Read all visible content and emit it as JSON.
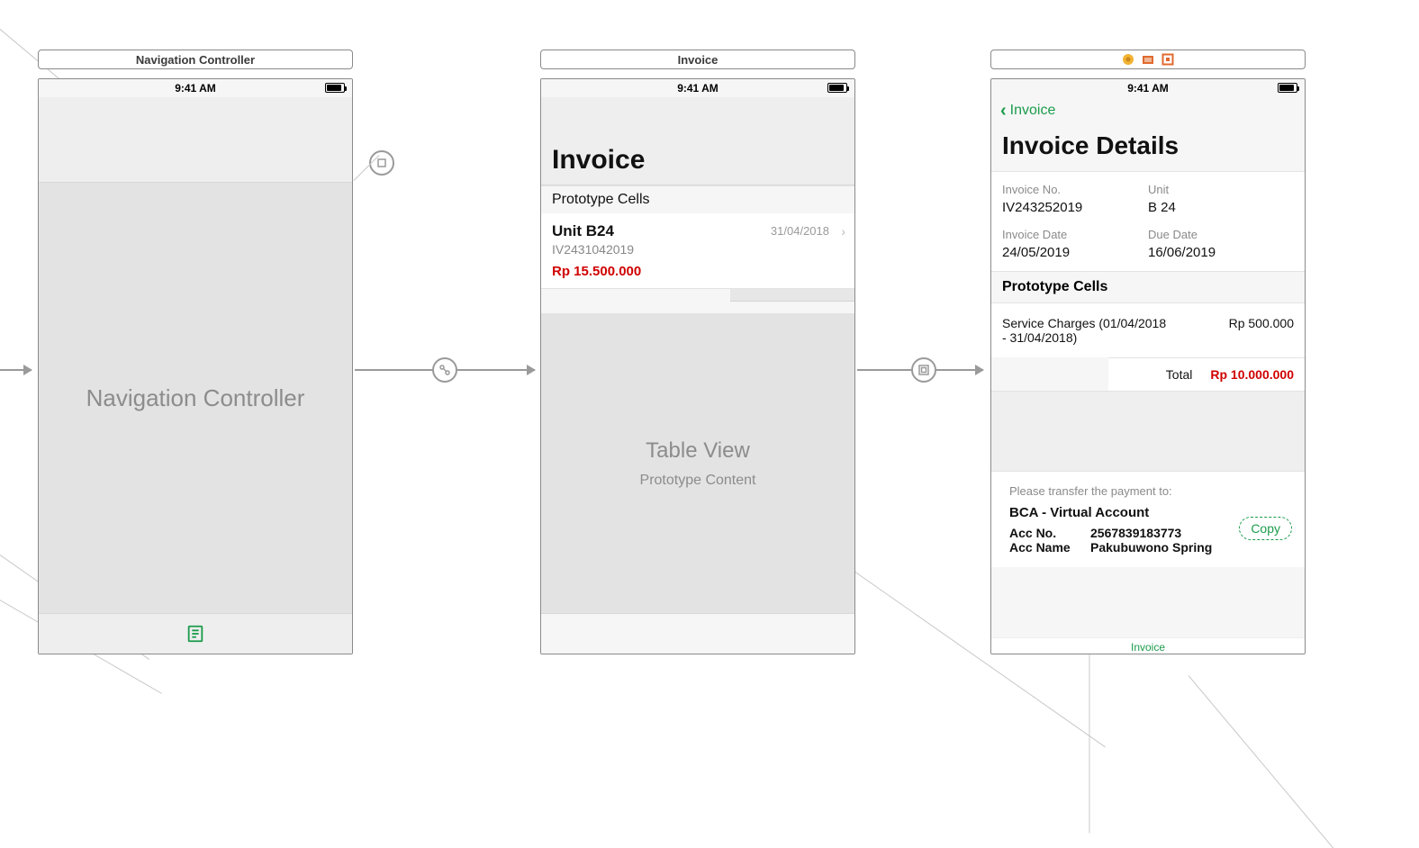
{
  "status_time": "9:41 AM",
  "scene1": {
    "label": "Navigation Controller",
    "body_title": "Navigation Controller"
  },
  "scene2": {
    "label": "Invoice",
    "title": "Invoice",
    "prototype_label": "Prototype Cells",
    "row": {
      "unit": "Unit B24",
      "invno": "IV2431042019",
      "amount": "Rp 15.500.000",
      "date": "31/04/2018"
    },
    "tableview_title": "Table View",
    "tableview_sub": "Prototype Content"
  },
  "scene3": {
    "back_label": "Invoice",
    "title": "Invoice Details",
    "meta": {
      "invno_label": "Invoice No.",
      "invno": "IV243252019",
      "unit_label": "Unit",
      "unit": "B 24",
      "invdate_label": "Invoice Date",
      "invdate": "24/05/2019",
      "duedate_label": "Due Date",
      "duedate": "16/06/2019"
    },
    "prototype_label": "Prototype Cells",
    "line": {
      "desc": "Service Charges (01/04/2018 - 31/04/2018)",
      "amount": "Rp 500.000"
    },
    "total_label": "Total",
    "total_value": "Rp 10.000.000",
    "pay": {
      "intro": "Please transfer the payment to:",
      "bank": "BCA - Virtual Account",
      "accno_label": "Acc No.",
      "accno": "2567839183773",
      "accname_label": "Acc Name",
      "accname": "Pakubuwono Spring",
      "copy": "Copy"
    },
    "tabbar_label": "Invoice"
  }
}
